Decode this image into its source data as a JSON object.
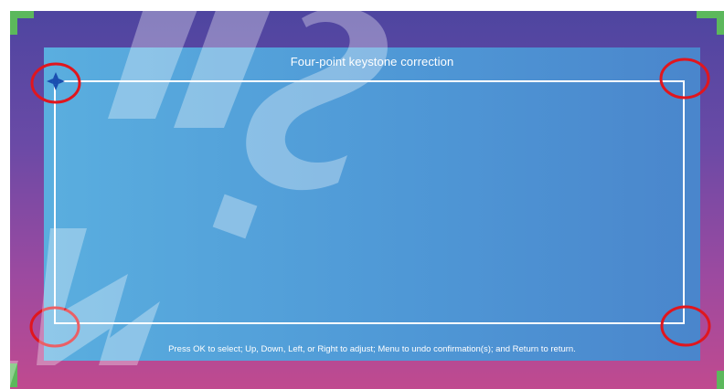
{
  "screen": {
    "title": "Four-point keystone correction",
    "instructions": "Press OK to select; Up, Down, Left, or Right to adjust; Menu to undo confirmation(s); and Return to return."
  },
  "corners": [
    {
      "name": "top-left",
      "selected": true
    },
    {
      "name": "top-right",
      "selected": false
    },
    {
      "name": "bottom-left",
      "selected": false
    },
    {
      "name": "bottom-right",
      "selected": false
    }
  ],
  "icons": {
    "selection_cursor": "four-way-arrow-cursor-icon",
    "highlight": "red-circle-highlight"
  },
  "colors": {
    "panel_blue": "#4f98d6",
    "highlight_red": "#e0161e",
    "frame_green": "#5cb85c",
    "background_top": "#4e45a0",
    "background_bottom": "#c04a8f"
  }
}
